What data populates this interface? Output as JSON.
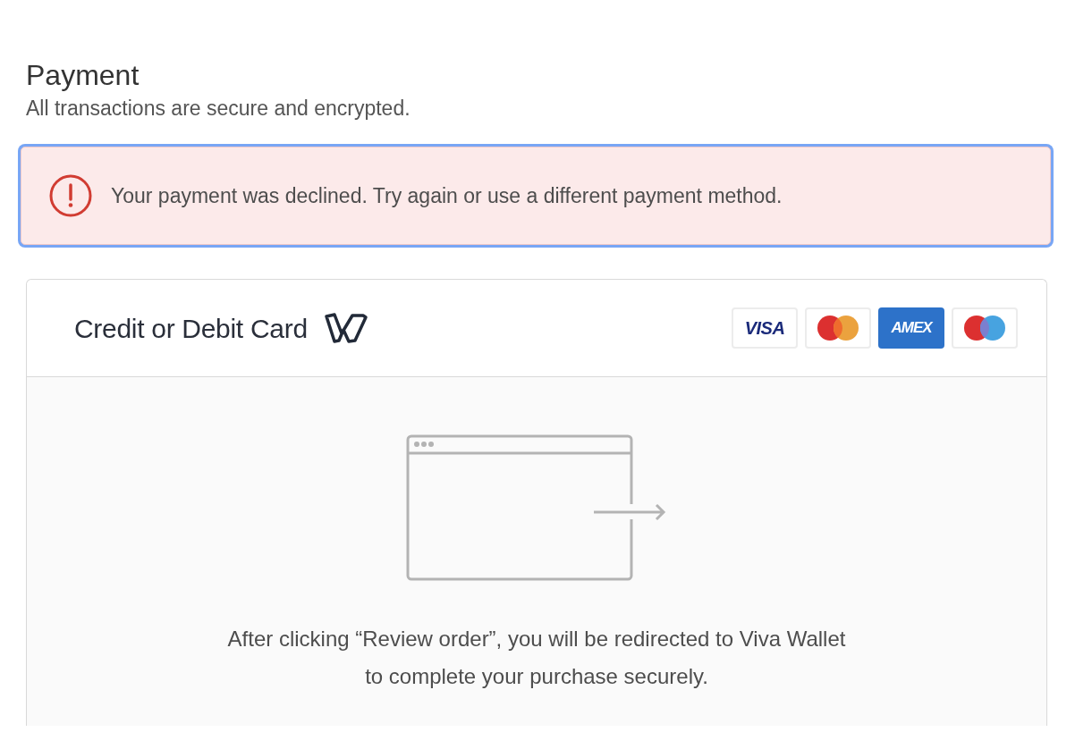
{
  "section": {
    "title": "Payment",
    "subtitle": "All transactions are secure and encrypted."
  },
  "alert": {
    "kind": "error",
    "focused": true,
    "message": "Your payment was declined. Try again or use a different payment method."
  },
  "payment_method": {
    "label": "Credit or Debit Card",
    "card_brands": [
      {
        "kind": "visa",
        "label": "VISA"
      },
      {
        "kind": "mastercard"
      },
      {
        "kind": "amex",
        "label": "AMEX"
      },
      {
        "kind": "maestro"
      }
    ],
    "redirect_lines": [
      "After clicking “Review order”, you will be redirected to Viva Wallet",
      "to complete your purchase securely."
    ]
  }
}
